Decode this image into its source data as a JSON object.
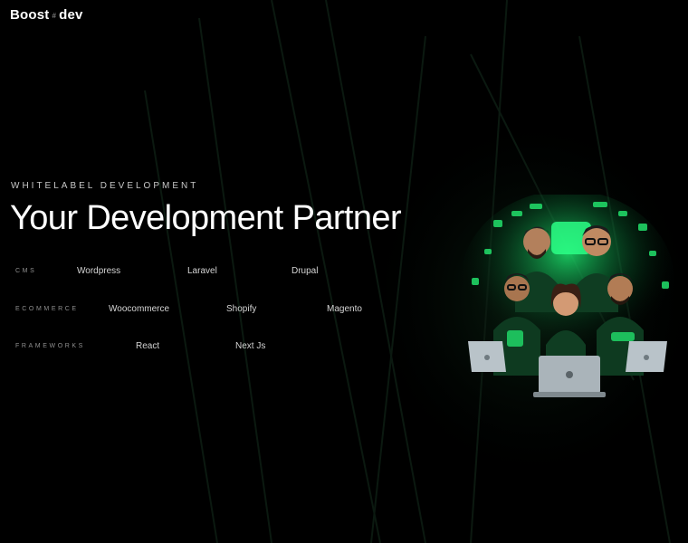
{
  "header": {
    "logo_left": "Boost",
    "logo_symbol": "#",
    "logo_right": "dev"
  },
  "hero": {
    "eyebrow": "WHITELABEL DEVELOPMENT",
    "title": "Your Development Partner",
    "illustration_icon": "developer-team-illustration"
  },
  "tech": {
    "cms": {
      "label": "CMS",
      "items": [
        "Wordpress",
        "Laravel",
        "Drupal"
      ]
    },
    "ecommerce": {
      "label": "ECOMMERCE",
      "items": [
        "Woocommerce",
        "Shopify",
        "Magento"
      ]
    },
    "frameworks": {
      "label": "FRAMEWORKS",
      "items": [
        "React",
        "Next Js"
      ]
    }
  },
  "colors": {
    "background": "#000000",
    "accent": "#22e06b",
    "text": "#ffffff"
  }
}
